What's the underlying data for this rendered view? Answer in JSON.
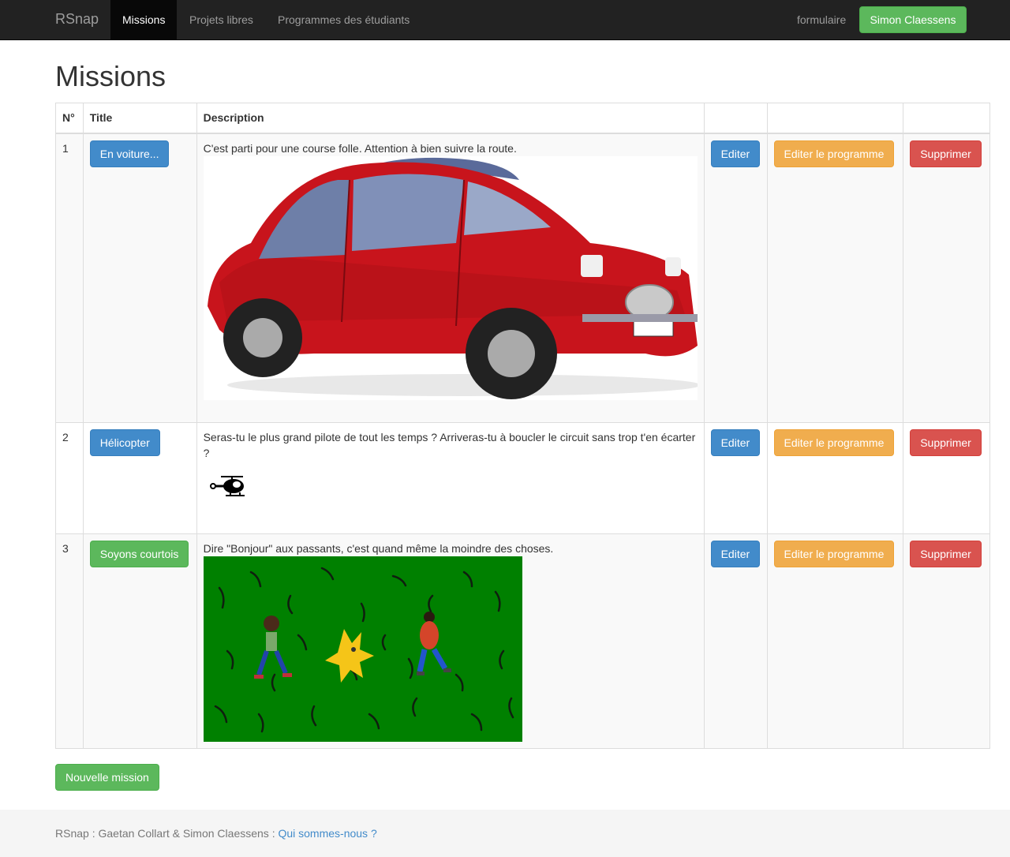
{
  "nav": {
    "brand": "RSnap",
    "items": [
      {
        "label": "Missions",
        "active": true
      },
      {
        "label": "Projets libres",
        "active": false
      },
      {
        "label": "Programmes des étudiants",
        "active": false
      }
    ],
    "right_link": "formulaire",
    "user_button": "Simon Claessens"
  },
  "page_title": "Missions",
  "table": {
    "headers": [
      "N°",
      "Title",
      "Description",
      "",
      "",
      ""
    ],
    "rows": [
      {
        "number": "1",
        "title": "En voiture...",
        "title_style": "primary",
        "description": "C'est parti pour une course folle. Attention à bien suivre la route.",
        "image": "red-car-image",
        "edit": "Editer",
        "edit_program": "Editer le programme",
        "delete": "Supprimer"
      },
      {
        "number": "2",
        "title": "Hélicopter",
        "title_style": "primary",
        "description": "Seras-tu le plus grand pilote de tout les temps ? Arriveras-tu à boucler le circuit sans trop t'en écarter ?",
        "image": "helicopter-icon",
        "edit": "Editer",
        "edit_program": "Editer le programme",
        "delete": "Supprimer"
      },
      {
        "number": "3",
        "title": "Soyons courtois",
        "title_style": "success",
        "description": "Dire \"Bonjour\" aux passants, c'est quand même la moindre des choses.",
        "image": "grass-scene-image",
        "edit": "Editer",
        "edit_program": "Editer le programme",
        "delete": "Supprimer"
      }
    ]
  },
  "new_mission_button": "Nouvelle mission",
  "footer": {
    "text": "RSnap : Gaetan Collart & Simon Claessens :",
    "link": "Qui sommes-nous ?"
  },
  "colors": {
    "navbar": "#222222",
    "primary": "#428bca",
    "success": "#5cb85c",
    "warning": "#f0ad4e",
    "danger": "#d9534f"
  }
}
